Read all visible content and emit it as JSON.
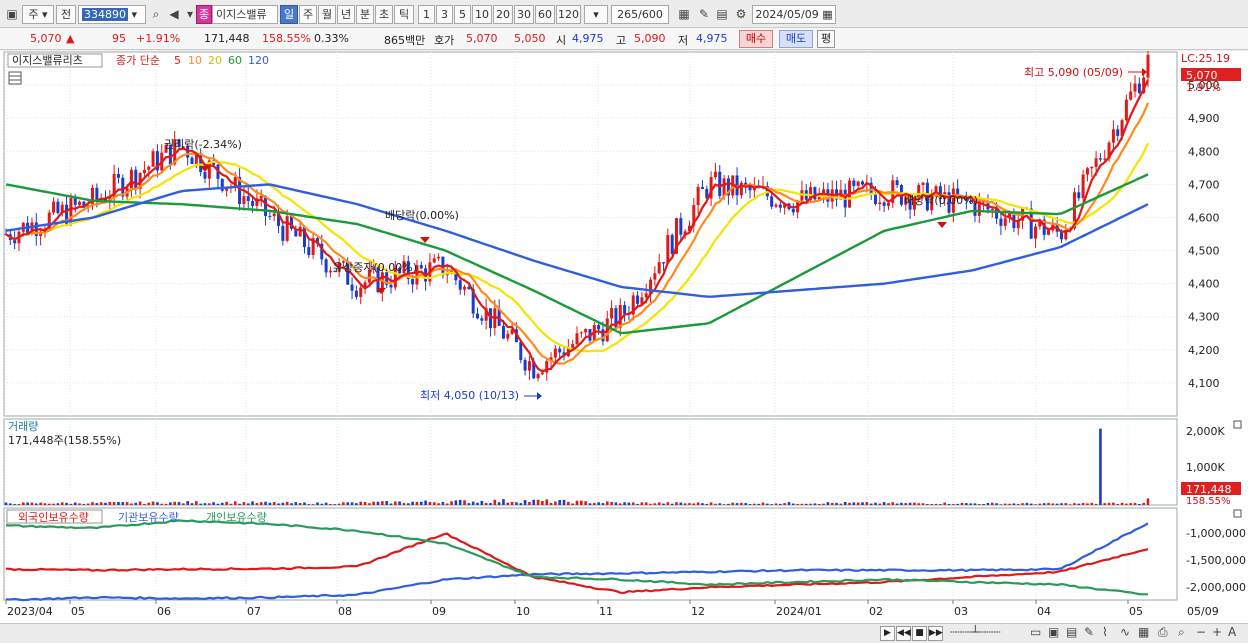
{
  "toolbar": {
    "market": "주",
    "prev": "전",
    "code": "334890",
    "name": "이지스밸류",
    "period_btns": [
      "일",
      "주",
      "월",
      "년",
      "분",
      "초",
      "틱"
    ],
    "active_period": "일",
    "interval_btns": [
      "1",
      "3",
      "5",
      "10",
      "20",
      "30",
      "60",
      "120"
    ],
    "count": "265",
    "count_max": "/600",
    "date": "2024/05/09",
    "special_btn": "종"
  },
  "quote": {
    "price": "5,070",
    "arrow": "▲",
    "change": "95",
    "change_pct": "+1.91%",
    "volume": "171,448",
    "vol_ratio": "158.55%",
    "turnover": "0.33%",
    "amount": "865백만",
    "ask_label": "호가",
    "ask": "5,070",
    "bid": "5,050",
    "open_label": "시",
    "open": "4,975",
    "high_label": "고",
    "high": "5,090",
    "low_label": "저",
    "low": "4,975",
    "buy_btn": "매수",
    "sell_btn": "매도",
    "eval_btn": "평"
  },
  "legend": {
    "stock": "이지스밸류리츠",
    "ma_label": "종가 단순",
    "ma_periods": [
      "5",
      "10",
      "20",
      "60",
      "120"
    ]
  },
  "annotations": {
    "high": "최고 5,090 (05/09)",
    "low": "최저 4,050 (10/13)",
    "rights": "권리락(-2.34%)",
    "div1": "배당락(0.00%)",
    "div2": "배당락(0.00%)",
    "rights_issue": "유상증자(0.00%)"
  },
  "price_tags": {
    "lc": "LC:25.19",
    "last": "5,070",
    "pct": "1.91%"
  },
  "volume_panel": {
    "title": "거래량",
    "value": "171,448주(158.55%)",
    "tag": "171,448",
    "tag_pct": "158.55%",
    "y_ticks": [
      "2,000K",
      "1,000K"
    ]
  },
  "holdings_panel": {
    "titles": [
      "외국인보유수량",
      "기관보유수량",
      "개인보유수량"
    ],
    "y_ticks": [
      "-1,000,000",
      "-1,500,000",
      "-2,000,000"
    ]
  },
  "x_axis": [
    "2023/04",
    "05",
    "06",
    "07",
    "08",
    "09",
    "10",
    "11",
    "12",
    "2024/01",
    "02",
    "03",
    "04",
    "05"
  ],
  "x_axis_end": "05/09",
  "colors": {
    "up": "#e01818",
    "down": "#1a3ccc",
    "ma5": "#e01818",
    "ma10": "#ff8a1c",
    "ma20": "#f5e400",
    "ma60": "#1a9a3a",
    "ma120": "#2f5fe0",
    "foreign": "#e01818",
    "institution": "#2f5fe0",
    "individual": "#2a9a5a"
  },
  "chart_data": [
    {
      "type": "line",
      "title": "이지스밸류리츠 일봉",
      "x": [
        "2023/04",
        "05",
        "06",
        "07",
        "08",
        "09",
        "10",
        "11",
        "12",
        "2024/01",
        "02",
        "03",
        "04",
        "05"
      ],
      "series": [
        {
          "name": "종가",
          "values": [
            4550,
            4650,
            4820,
            4600,
            4400,
            4450,
            4150,
            4300,
            4700,
            4650,
            4680,
            4640,
            4550,
            5070
          ]
        },
        {
          "name": "60",
          "values": [
            4700,
            4650,
            4640,
            4620,
            4580,
            4500,
            4380,
            4250,
            4280,
            4420,
            4560,
            4620,
            4610,
            4730
          ]
        },
        {
          "name": "120",
          "values": [
            4560,
            4600,
            4680,
            4700,
            4640,
            4560,
            4470,
            4390,
            4360,
            4380,
            4400,
            4440,
            4510,
            4640
          ]
        }
      ],
      "yticks": [
        4100,
        4200,
        4300,
        4400,
        4500,
        4600,
        4700,
        4800,
        4900,
        5000
      ],
      "ylim": [
        4000,
        5100
      ]
    },
    {
      "type": "bar",
      "title": "거래량",
      "x": [
        "2023/04",
        "05",
        "06",
        "07",
        "08",
        "09",
        "10",
        "11",
        "12",
        "2024/01",
        "02",
        "03",
        "04",
        "05"
      ],
      "values": [
        50000,
        60000,
        80000,
        50000,
        90000,
        120000,
        60000,
        50000,
        60000,
        50000,
        40000,
        50000,
        2000000,
        171448
      ],
      "ylim": [
        0,
        2200000
      ]
    },
    {
      "type": "line",
      "title": "보유수량",
      "x": [
        "2023/04",
        "05",
        "06",
        "07",
        "08",
        "09",
        "10",
        "11",
        "12",
        "2024/01",
        "02",
        "03",
        "04",
        "05"
      ],
      "series": [
        {
          "name": "외국인보유수량",
          "values": [
            -1700000,
            -1720000,
            -1700000,
            -1690000,
            -1650000,
            -1000000,
            -1850000,
            -2150000,
            -2050000,
            -2000000,
            -1950000,
            -1850000,
            -1750000,
            -1300000
          ]
        },
        {
          "name": "기관보유수량",
          "values": [
            -2300000,
            -2250000,
            -2270000,
            -2250000,
            -2200000,
            -1900000,
            -1800000,
            -1780000,
            -1750000,
            -1720000,
            -1720000,
            -1720000,
            -1700000,
            -800000
          ]
        },
        {
          "name": "개인보유수량",
          "values": [
            -850000,
            -900000,
            -750000,
            -820000,
            -950000,
            -1200000,
            -1850000,
            -1900000,
            -2000000,
            -1950000,
            -1900000,
            -1950000,
            -2000000,
            -2200000
          ]
        }
      ],
      "yticks": [
        -1000000,
        -1500000,
        -2000000
      ]
    }
  ]
}
